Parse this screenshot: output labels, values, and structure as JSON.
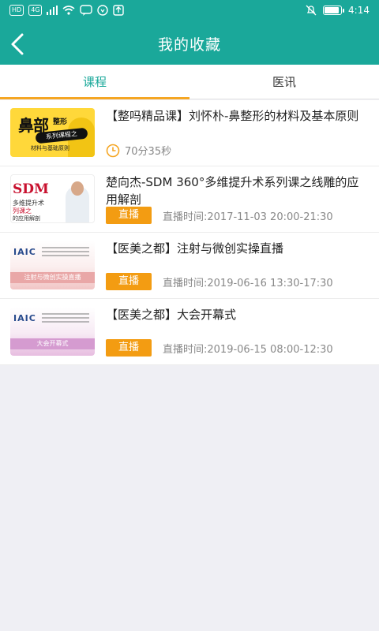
{
  "status_bar": {
    "left_chips": [
      "HD",
      "4G"
    ],
    "time": "4:14",
    "icons": [
      "signal-icon",
      "wifi-icon",
      "chat-icon",
      "shield-icon",
      "upload-icon",
      "mute-icon",
      "battery-icon"
    ]
  },
  "header": {
    "title": "我的收藏",
    "back_icon": "chevron-left-icon"
  },
  "tabs": [
    {
      "label": "课程",
      "active": true
    },
    {
      "label": "医讯",
      "active": false
    }
  ],
  "colors": {
    "primary": "#1aa89a",
    "accent": "#f5a623",
    "badge": "#f39c12"
  },
  "items": [
    {
      "title": "【整吗精品课】刘怀朴-鼻整形的材料及基本原则",
      "duration": "70分35秒",
      "thumb": {
        "big": "鼻部",
        "small": "整形",
        "ribbon": "系列课程之",
        "sub": "材料与基础原则"
      }
    },
    {
      "title": "楚向杰-SDM 360°多维提升术系列课之线雕的应用解剖",
      "badge": "直播",
      "time": "直播时间:2017-11-03 20:00-21:30",
      "thumb": {
        "logo": "SDM",
        "l1": "多维提升术",
        "l2": "列课之",
        "l3": "的应用解剖"
      }
    },
    {
      "title": "【医美之都】注射与微创实操直播",
      "badge": "直播",
      "time": "直播时间:2019-06-16 13:30-17:30",
      "thumb": {
        "logo": "IAIC",
        "band": "注射与微创实操直播"
      }
    },
    {
      "title": "【医美之都】大会开幕式",
      "badge": "直播",
      "time": "直播时间:2019-06-15 08:00-12:30",
      "thumb": {
        "logo": "IAIC",
        "band": "大会开幕式"
      }
    }
  ]
}
